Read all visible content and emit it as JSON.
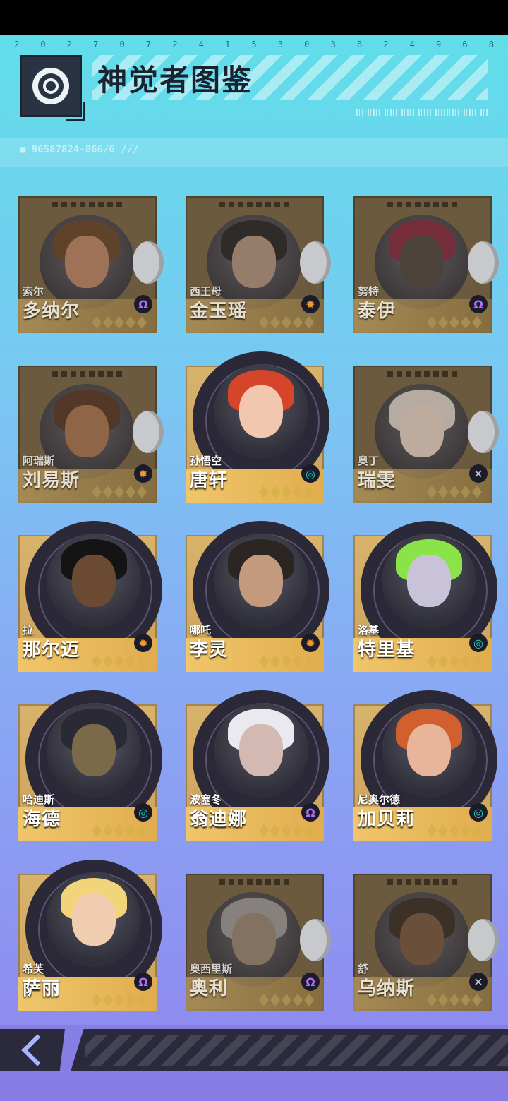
{
  "header": {
    "digits": [
      "2",
      "0",
      "2",
      "7",
      "0",
      "7",
      "2",
      "4",
      "1",
      "5",
      "3",
      "0",
      "3",
      "8",
      "2",
      "4",
      "9",
      "6",
      "8"
    ],
    "title": "神觉者图鉴",
    "code": "■ 96587824-866/6 ///"
  },
  "cards": [
    {
      "alias": "索尔",
      "name": "多纳尔",
      "faction": "purple",
      "unlocked": false
    },
    {
      "alias": "西王母",
      "name": "金玉瑶",
      "faction": "orange",
      "unlocked": false
    },
    {
      "alias": "努特",
      "name": "泰伊",
      "faction": "purple",
      "unlocked": false
    },
    {
      "alias": "阿瑞斯",
      "name": "刘易斯",
      "faction": "orange",
      "unlocked": false
    },
    {
      "alias": "孙悟空",
      "name": "唐轩",
      "faction": "teal",
      "unlocked": true
    },
    {
      "alias": "奥丁",
      "name": "瑞雯",
      "faction": "grey",
      "unlocked": false
    },
    {
      "alias": "拉",
      "name": "那尔迈",
      "faction": "orange",
      "unlocked": true
    },
    {
      "alias": "哪吒",
      "name": "李灵",
      "faction": "orange",
      "unlocked": true
    },
    {
      "alias": "洛基",
      "name": "特里基",
      "faction": "teal",
      "unlocked": true
    },
    {
      "alias": "哈迪斯",
      "name": "海德",
      "faction": "teal",
      "unlocked": true
    },
    {
      "alias": "波塞冬",
      "name": "翁迪娜",
      "faction": "purple",
      "unlocked": true
    },
    {
      "alias": "尼奥尔德",
      "name": "加贝莉",
      "faction": "teal",
      "unlocked": true
    },
    {
      "alias": "希芙",
      "name": "萨丽",
      "faction": "purple",
      "unlocked": true
    },
    {
      "alias": "奥西里斯",
      "name": "奥利",
      "faction": "purple",
      "unlocked": false
    },
    {
      "alias": "舒",
      "name": "乌纳斯",
      "faction": "grey",
      "unlocked": false
    }
  ],
  "colors": {
    "faction_purple": "#b46cff",
    "faction_orange": "#f59a2a",
    "faction_teal": "#1fd0c0",
    "faction_grey": "#c9cfe0"
  },
  "icons": {
    "back": "chevron-left-icon"
  }
}
